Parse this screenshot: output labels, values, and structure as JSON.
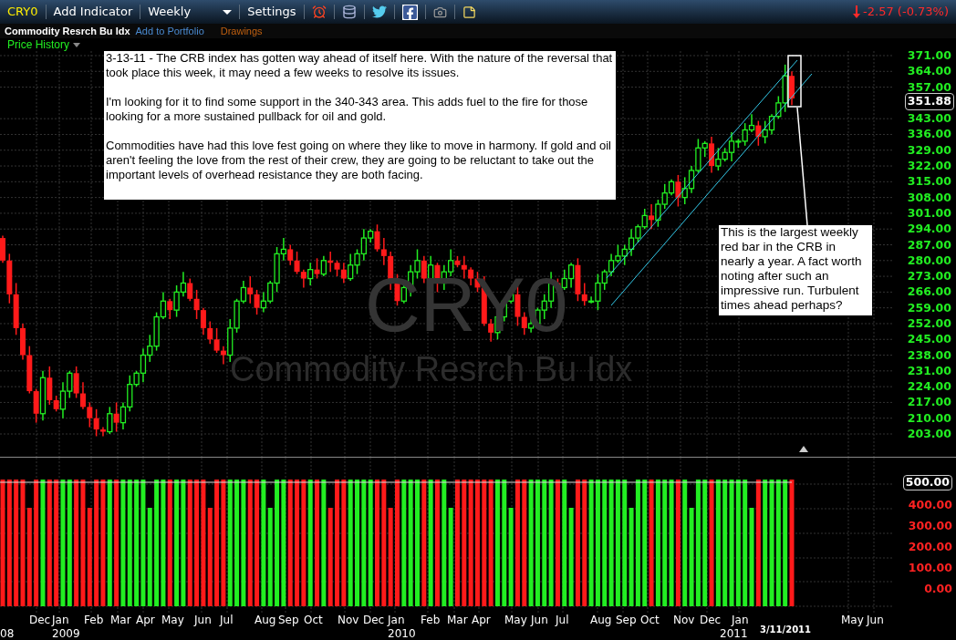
{
  "toolbar": {
    "symbol": "CRY0",
    "add_indicator": "Add Indicator",
    "interval": "Weekly",
    "settings": "Settings",
    "change": {
      "kind": "down",
      "text": "-2.57 (-0.73%)"
    }
  },
  "subbar": {
    "name": "Commodity Resrch Bu Idx",
    "add_to_portfolio": "Add to Portfolio",
    "drawings": "Drawings"
  },
  "panel": {
    "title": "Price History"
  },
  "chart": {
    "watermark_symbol": "CRY0",
    "watermark_name": "Commodity Resrch Bu Idx",
    "price_ticks": [
      "371.00",
      "364.00",
      "357.00",
      "343.00",
      "336.00",
      "329.00",
      "322.00",
      "315.00",
      "308.00",
      "301.00",
      "294.00",
      "287.00",
      "280.00",
      "273.00",
      "266.00",
      "259.00",
      "252.00",
      "245.00",
      "238.00",
      "231.00",
      "224.00",
      "217.00",
      "210.00",
      "203.00"
    ],
    "current_price": "351.88",
    "notes": [
      {
        "kind": "commentary",
        "paragraphs": [
          "3-13-11 - The CRB index has gotten way ahead of itself here. With the nature of the reversal that took place this week, it may need a few weeks to resolve its issues.",
          "I'm looking for it to find some support in the 340-343 area. This adds fuel to the fire for those looking for a more sustained pullback for oil and gold.",
          "Commodities have had this love fest going on where they like to move in harmony. If gold and oil aren't feeling the love from the rest of their crew, they are going to be reluctant to take out the important levels of overhead resistance they are both facing."
        ]
      },
      {
        "kind": "callout",
        "paragraphs": [
          "This is the largest weekly red bar in the CRB in nearly a year. A fact worth noting after such an impressive run. Turbulent times ahead perhaps?"
        ]
      }
    ]
  },
  "volume": {
    "max_label": "500.00",
    "ticks": [
      "400.00",
      "300.00",
      "200.00",
      "100.00",
      "0.00"
    ]
  },
  "x_axis": {
    "months": [
      "Dec",
      "Jan",
      "Feb",
      "Mar",
      "Apr",
      "May",
      "Jun",
      "Jul",
      "Aug",
      "Sep",
      "Oct",
      "Nov",
      "Dec",
      "Jan",
      "Feb",
      "Mar",
      "Apr",
      "May",
      "Jun",
      "Jul",
      "Aug",
      "Sep",
      "Oct",
      "Nov",
      "Dec",
      "Jan",
      "May",
      "Jun"
    ],
    "years": [
      "08",
      "2009",
      "2010",
      "2011"
    ],
    "current_date": "3/11/2011"
  }
}
